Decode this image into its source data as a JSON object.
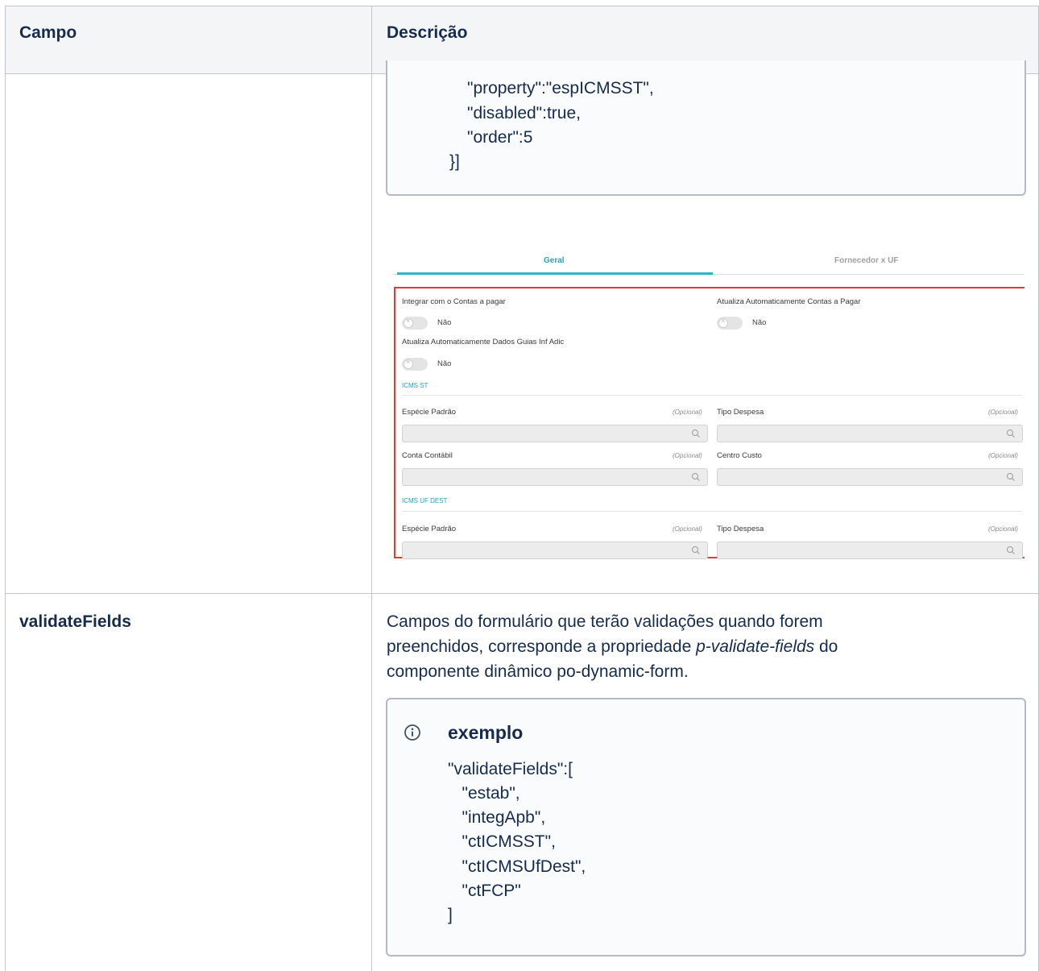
{
  "table": {
    "header": {
      "col1": "Campo",
      "col2": "Descrição"
    }
  },
  "row1": {
    "code_lines": [
      "\"property\":\"espICMSST\",",
      "\"disabled\":true,",
      "\"order\":5",
      "}]"
    ],
    "screenshot": {
      "tabs": [
        "Geral",
        "Fornecedor x UF"
      ],
      "toggles": [
        {
          "label": "Integrar com o Contas a pagar",
          "value": "Não"
        },
        {
          "label": "Atualiza Automaticamente Contas a Pagar",
          "value": "Não"
        },
        {
          "label": "Atualiza Automaticamente Dados Guias Inf Adic",
          "value": "Não"
        }
      ],
      "sections": [
        "ICMS ST",
        "ICMS UF DEST"
      ],
      "fields": {
        "especie": "Espécie Padrão",
        "tipo": "Tipo Despesa",
        "conta": "Conta Contábil",
        "centro": "Centro Custo",
        "opcional": "(Opcional)"
      },
      "colors": {
        "accent": "#29b6c5",
        "highlight": "#e53935"
      }
    }
  },
  "row2": {
    "field": "validateFields",
    "description": {
      "line1": "Campos do formulário que terão validações quando forem",
      "line2_pre": "preenchidos, corresponde a propriedade ",
      "line2_em": "p-validate-fields",
      "line2_post": " do",
      "line3": "componente dinâmico po-dynamic-form."
    },
    "info_title": "exemplo",
    "code_lines": [
      "\"validateFields\":[",
      "   \"estab\",",
      "   \"integApb\",",
      "   \"ctICMSST\",",
      "   \"ctICMSUfDest\",",
      "   \"ctFCP\"",
      "]"
    ]
  }
}
